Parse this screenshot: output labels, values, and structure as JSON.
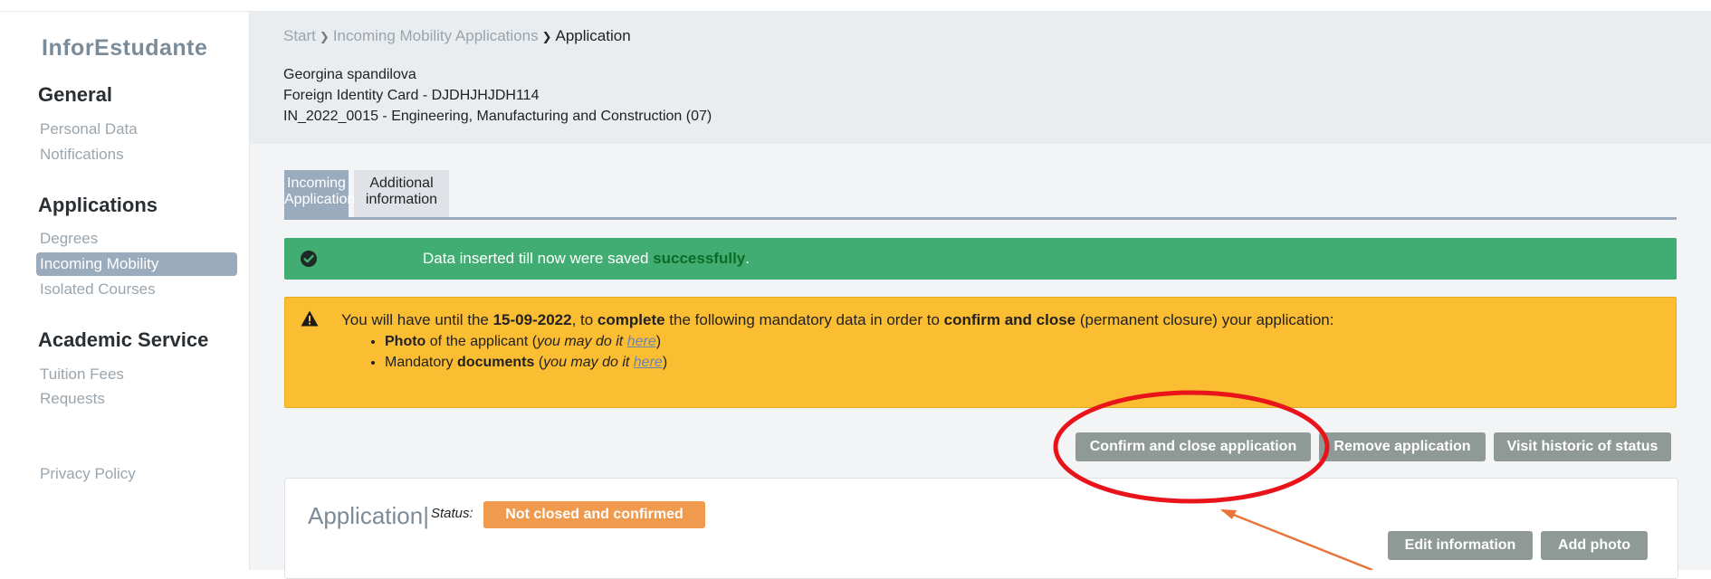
{
  "sidebar": {
    "brand": "InforEstudante",
    "sections": [
      {
        "title": "General",
        "items": [
          "Personal Data",
          "Notifications"
        ]
      },
      {
        "title": "Applications",
        "items": [
          "Degrees",
          "Incoming Mobility",
          "Isolated Courses"
        ]
      },
      {
        "title": "Academic Service",
        "items": [
          "Tuition Fees",
          "Requests"
        ]
      }
    ],
    "footer_link": "Privacy Policy"
  },
  "header": {
    "breadcrumb": [
      "Start",
      "Incoming Mobility Applications",
      "Application"
    ],
    "applicant_name": "Georgina spandilova",
    "identity": "Foreign Identity Card - DJDHJHJDH114",
    "program": "IN_2022_0015 - Engineering, Manufacturing and Construction (07)"
  },
  "tabs": [
    {
      "line1": "Incoming",
      "line2": "Application"
    },
    {
      "line1": "Additional",
      "line2": "information"
    }
  ],
  "alert_success": {
    "text_before": "Data inserted till now were saved ",
    "highlight": "successfully",
    "text_after": "."
  },
  "alert_warning": {
    "t1": "You will have until the ",
    "date": "15-09-2022",
    "t2": ", to ",
    "complete": "complete",
    "t3": " the following mandatory data in order to ",
    "confirm_close": "confirm and close",
    "t4": " (permanent closure) your application:",
    "item1_bold": "Photo",
    "item1_text": " of the applicant (",
    "item1_italic": "you may do it ",
    "link_text": "here",
    "item2_text": "Mandatory ",
    "item2_bold": "documents",
    "item2_open": " (",
    "close_paren": ")"
  },
  "actions": {
    "confirm_close": "Confirm and close application",
    "remove": "Remove application",
    "historic": "Visit historic of status"
  },
  "panel": {
    "title": "Application",
    "status_label": "Status:",
    "status_value": "Not closed and confirmed",
    "edit": "Edit information",
    "add_photo": "Add photo"
  },
  "colors": {
    "accent": "#9aabbd",
    "success": "#41ad72",
    "warning": "#fbbd32",
    "status_badge": "#ef9a4d",
    "annotation": "#e8141a"
  }
}
